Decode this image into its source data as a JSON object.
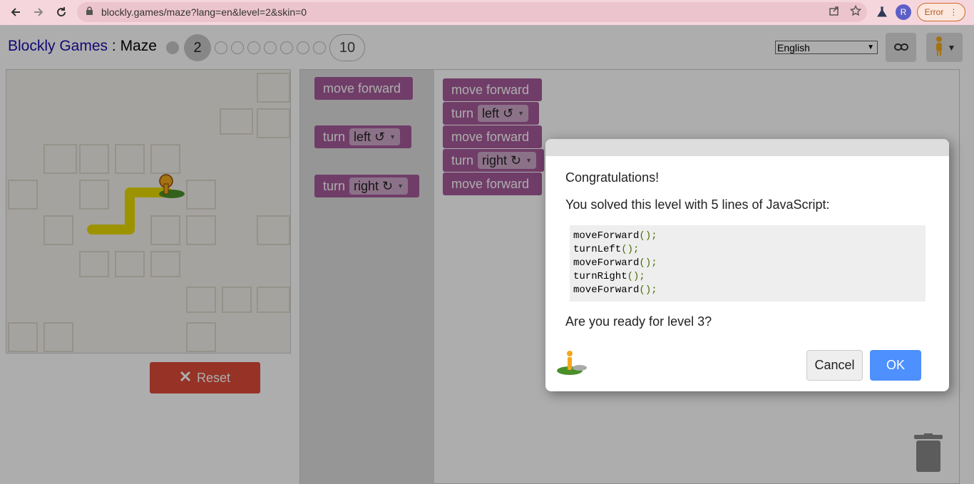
{
  "browser": {
    "url": "blockly.games/maze?lang=en&level=2&skin=0",
    "profile_initial": "R",
    "error_label": "Error"
  },
  "header": {
    "brand": "Blockly Games",
    "separator": " : ",
    "page": "Maze",
    "current_level": "2",
    "last_level": "10",
    "language": "English"
  },
  "maze": {
    "reset_label": "Reset"
  },
  "toolbox": {
    "blocks": [
      {
        "text": "move forward"
      },
      {
        "text": "turn",
        "option": "left ↺"
      },
      {
        "text": "turn",
        "option": "right ↻"
      }
    ]
  },
  "program": {
    "blocks": [
      {
        "text": "move forward"
      },
      {
        "text": "turn",
        "option": "left ↺"
      },
      {
        "text": "move forward"
      },
      {
        "text": "turn",
        "option": "right ↻"
      },
      {
        "text": "move forward"
      }
    ]
  },
  "dialog": {
    "congrats": "Congratulations!",
    "solved": "You solved this level with 5 lines of JavaScript:",
    "code": [
      "moveForward",
      "turnLeft",
      "moveForward",
      "turnRight",
      "moveForward"
    ],
    "code_suffix": "();",
    "question": "Are you ready for level 3?",
    "cancel_label": "Cancel",
    "ok_label": "OK"
  },
  "colors": {
    "block": "#a55b9a",
    "ok_button": "#4d90fe",
    "reset_button": "#dd4b39",
    "path": "#e8d900"
  }
}
